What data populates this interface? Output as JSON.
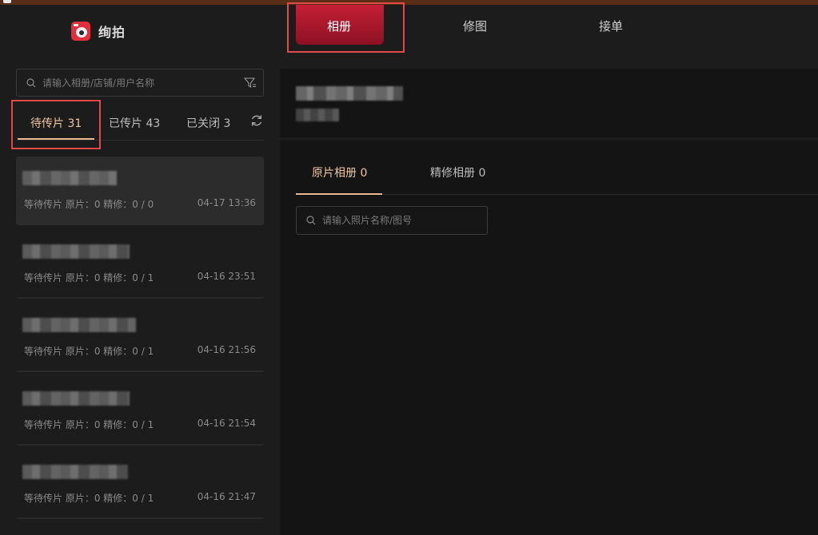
{
  "app": {
    "name": "绚拍"
  },
  "nav": {
    "tabs": [
      {
        "label": "相册"
      },
      {
        "label": "修图"
      },
      {
        "label": "接单"
      }
    ]
  },
  "left": {
    "search_placeholder": "请输入相册/店铺/用户名称",
    "status_tabs": [
      {
        "label": "待传片 31"
      },
      {
        "label": "已传片 43"
      },
      {
        "label": "已关闭 3"
      }
    ],
    "cards": [
      {
        "meta": "等待传片 原片：0 精修：0 / 0",
        "time": "04-17 13:36"
      },
      {
        "meta": "等待传片 原片：0 精修：0 / 1",
        "time": "04-16 23:51"
      },
      {
        "meta": "等待传片 原片：0 精修：0 / 1",
        "time": "04-16 21:56"
      },
      {
        "meta": "等待传片 原片：0 精修：0 / 1",
        "time": "04-16 21:54"
      },
      {
        "meta": "等待传片 原片：0 精修：0 / 1",
        "time": "04-16 21:47"
      }
    ]
  },
  "album": {
    "subtabs": [
      {
        "label": "原片相册 0"
      },
      {
        "label": "精修相册 0"
      }
    ],
    "search_placeholder": "请输入照片名称/图号"
  },
  "colors": {
    "accent_red": "#c51f35",
    "accent_gold": "#e6b98f",
    "highlight_box": "#e24a4a"
  }
}
